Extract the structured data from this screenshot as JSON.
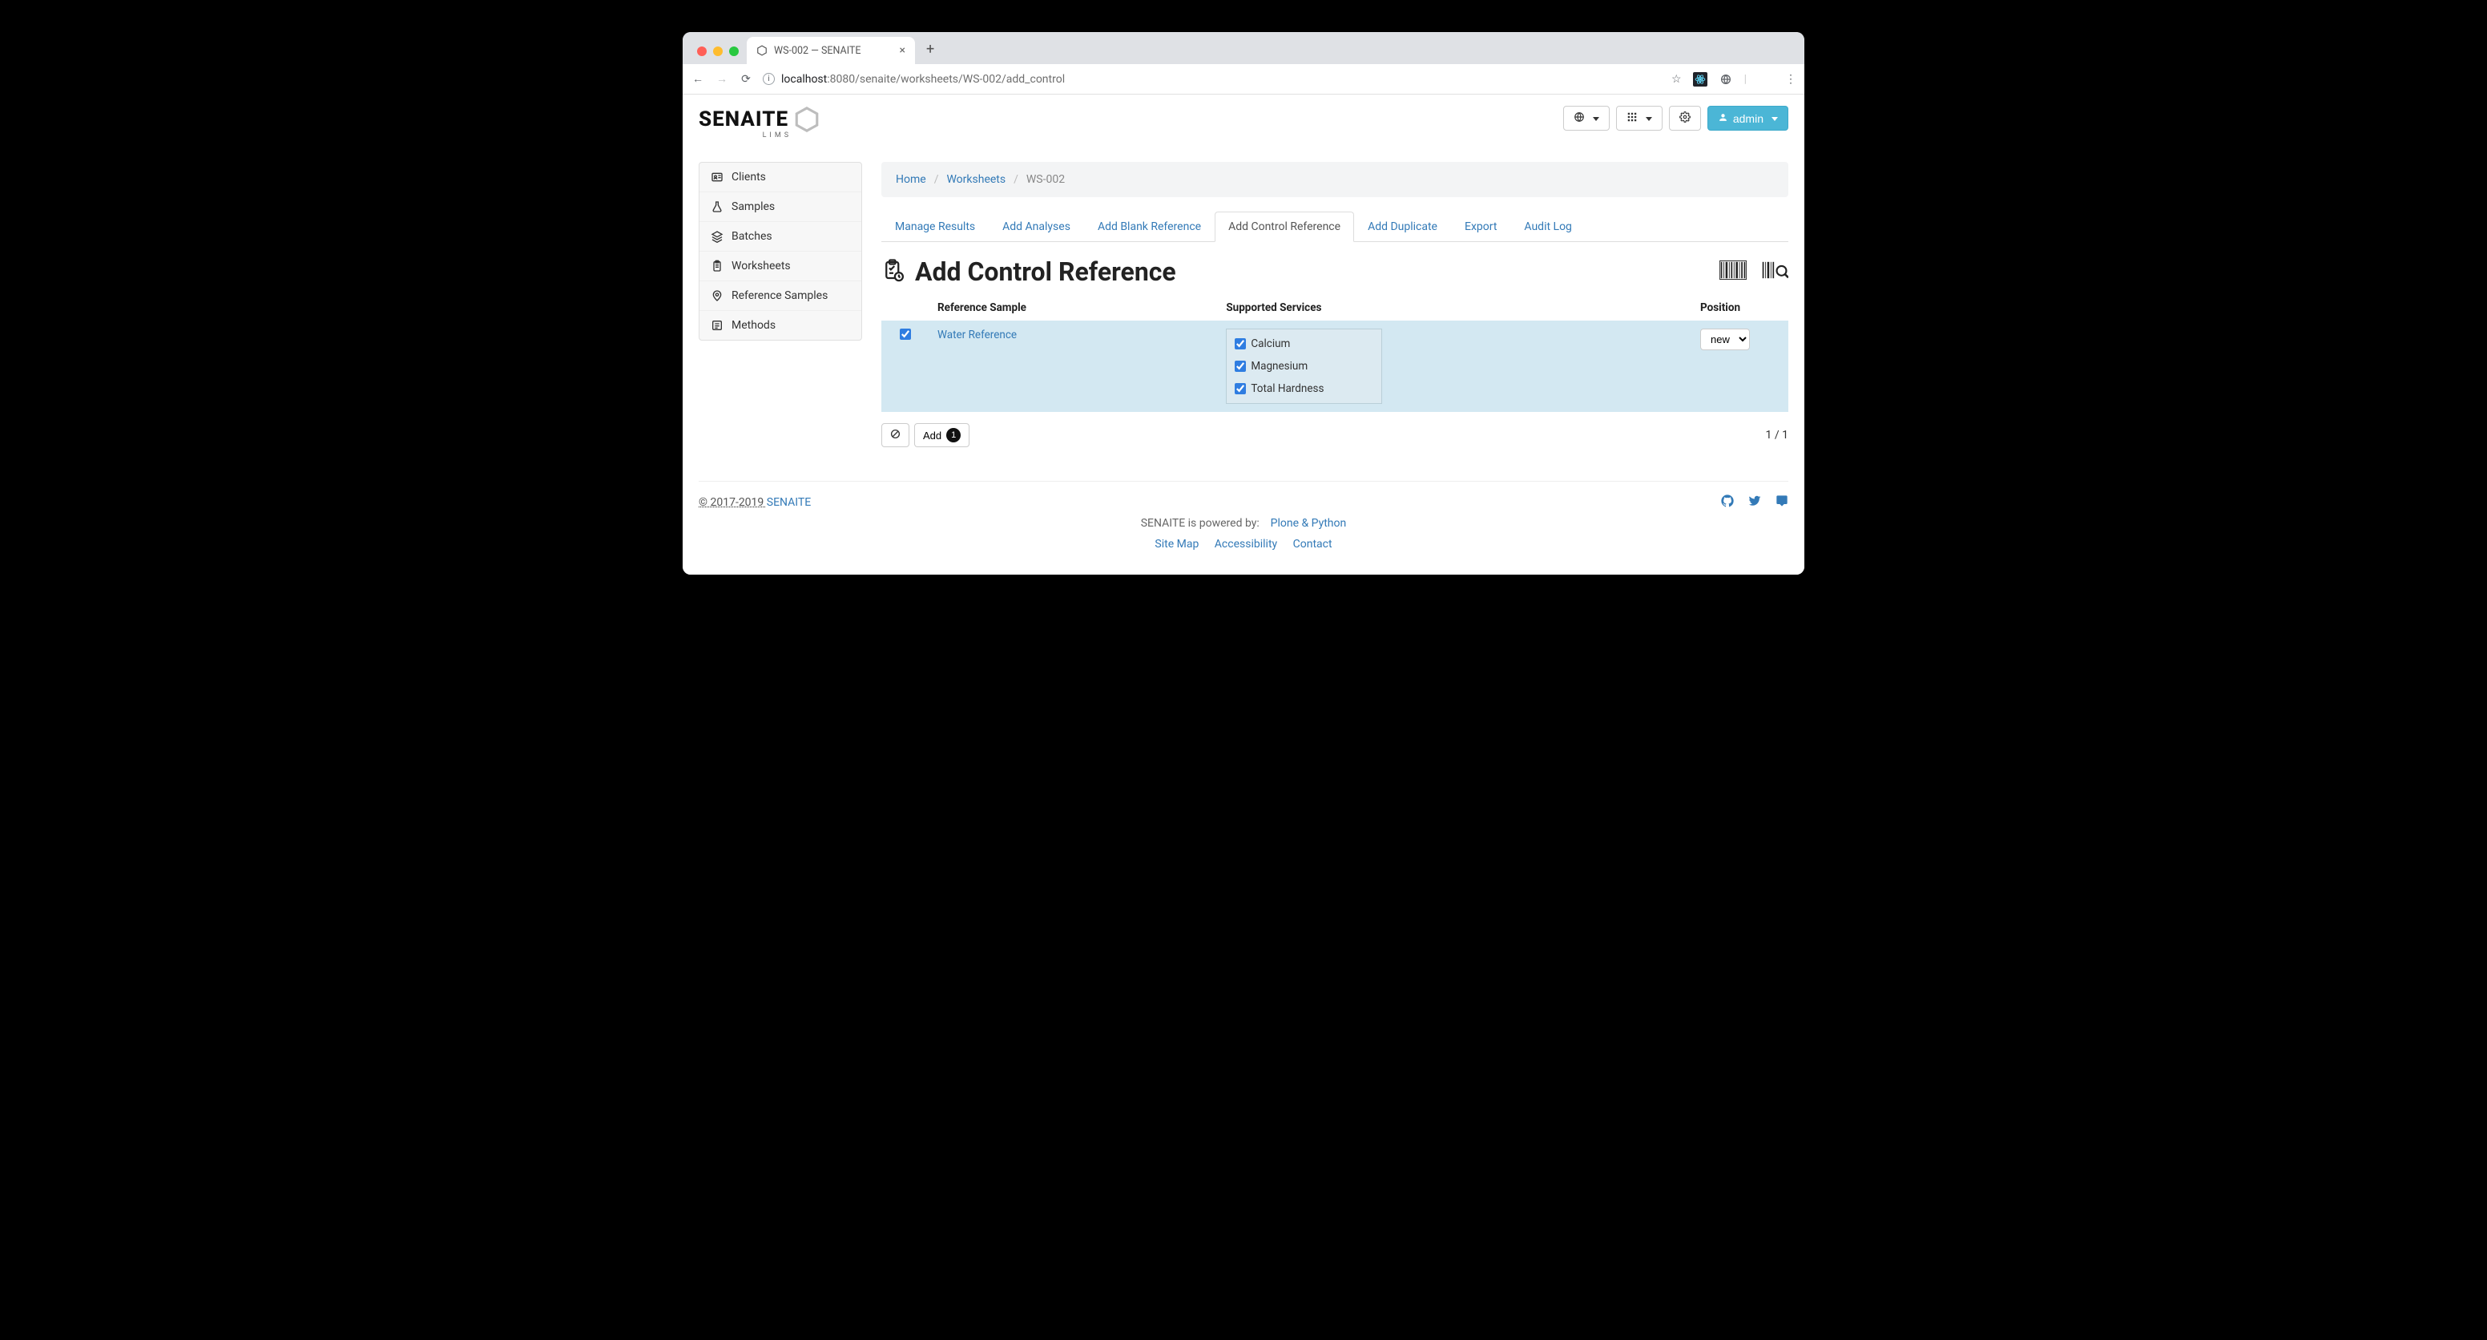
{
  "browser": {
    "tab_title": "WS-002 — SENAITE",
    "url_host": "localhost",
    "url_port_path": ":8080/senaite/worksheets/WS-002/add_control"
  },
  "header": {
    "logo_text": "SENAITE",
    "logo_sub": "LIMS",
    "user_label": "admin"
  },
  "sidebar": {
    "items": [
      {
        "label": "Clients"
      },
      {
        "label": "Samples"
      },
      {
        "label": "Batches"
      },
      {
        "label": "Worksheets"
      },
      {
        "label": "Reference Samples"
      },
      {
        "label": "Methods"
      }
    ]
  },
  "breadcrumb": {
    "home": "Home",
    "parent": "Worksheets",
    "current": "WS-002"
  },
  "tabs": [
    {
      "label": "Manage Results"
    },
    {
      "label": "Add Analyses"
    },
    {
      "label": "Add Blank Reference"
    },
    {
      "label": "Add Control Reference",
      "active": true
    },
    {
      "label": "Add Duplicate"
    },
    {
      "label": "Export"
    },
    {
      "label": "Audit Log"
    }
  ],
  "page_title": "Add Control Reference",
  "table": {
    "headers": {
      "ref_sample": "Reference Sample",
      "services": "Supported Services",
      "position": "Position"
    },
    "rows": [
      {
        "selected": true,
        "reference_sample": "Water Reference",
        "services": [
          {
            "label": "Calcium",
            "checked": true
          },
          {
            "label": "Magnesium",
            "checked": true
          },
          {
            "label": "Total Hardness",
            "checked": true
          }
        ],
        "position": "new"
      }
    ]
  },
  "actions": {
    "add_label": "Add",
    "add_count": "1"
  },
  "paging": "1 / 1",
  "footer": {
    "copyright_prefix": "© 2017-2019 ",
    "copyright_link": "SENAITE",
    "powered_prefix": "SENAITE is powered by:",
    "powered_link": "Plone & Python",
    "links": {
      "sitemap": "Site Map",
      "accessibility": "Accessibility",
      "contact": "Contact"
    }
  }
}
